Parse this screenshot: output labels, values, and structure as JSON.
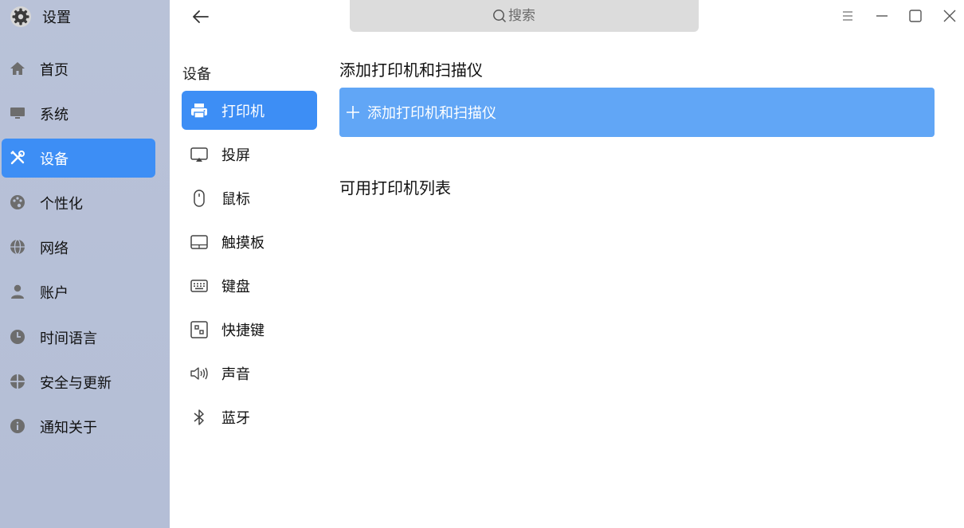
{
  "app": {
    "title": "设置"
  },
  "sidebar": {
    "items": [
      {
        "label": "首页",
        "icon": "home-icon"
      },
      {
        "label": "系统",
        "icon": "monitor-icon"
      },
      {
        "label": "设备",
        "icon": "tools-icon",
        "active": true
      },
      {
        "label": "个性化",
        "icon": "palette-icon"
      },
      {
        "label": "网络",
        "icon": "globe-icon"
      },
      {
        "label": "账户",
        "icon": "user-icon"
      },
      {
        "label": "时间语言",
        "icon": "clock-icon"
      },
      {
        "label": "安全与更新",
        "icon": "shield-icon"
      },
      {
        "label": "通知关于",
        "icon": "info-icon"
      }
    ]
  },
  "header": {
    "search_placeholder": "搜索",
    "buttons": [
      "back-arrow-icon",
      "menu-icon",
      "minimize-icon",
      "maximize-icon",
      "close-icon"
    ]
  },
  "subnav": {
    "title": "设备",
    "items": [
      {
        "label": "打印机",
        "icon": "printer-icon",
        "active": true
      },
      {
        "label": "投屏",
        "icon": "cast-screen-icon"
      },
      {
        "label": "鼠标",
        "icon": "mouse-icon"
      },
      {
        "label": "触摸板",
        "icon": "touchpad-icon"
      },
      {
        "label": "键盘",
        "icon": "keyboard-icon"
      },
      {
        "label": "快捷键",
        "icon": "shortcut-icon"
      },
      {
        "label": "声音",
        "icon": "speaker-icon"
      },
      {
        "label": "蓝牙",
        "icon": "bluetooth-icon"
      }
    ]
  },
  "main": {
    "add_section_title": "添加打印机和扫描仪",
    "add_button_label": "添加打印机和扫描仪",
    "list_section_title": "可用打印机列表"
  },
  "colors": {
    "accent": "#3d8ef5",
    "button": "#61a6f6",
    "sidebar": "#b8c1d7",
    "search": "#dcdcdc"
  }
}
